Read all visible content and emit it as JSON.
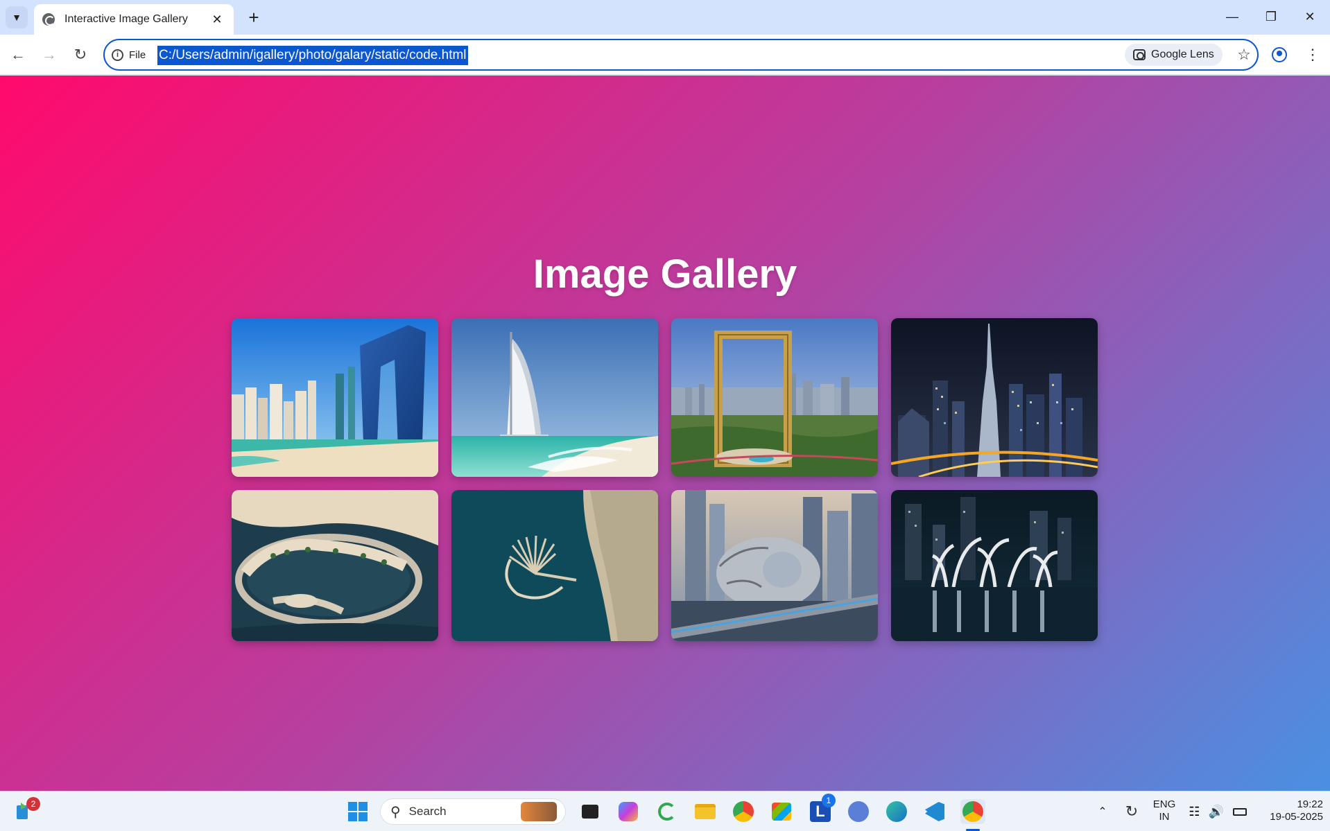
{
  "browser": {
    "tab_title": "Interactive Image Gallery",
    "site_info_label": "File",
    "url": "C:/Users/admin/igallery/photo/galary/static/code.html",
    "lens_label": "Google Lens"
  },
  "page": {
    "title": "Image Gallery",
    "gallery": [
      {
        "subject": "Dubai Marina beach and skyscrapers"
      },
      {
        "subject": "Burj Al Arab hotel on the beach"
      },
      {
        "subject": "Dubai Frame"
      },
      {
        "subject": "Burj Khalifa skyline at night"
      },
      {
        "subject": "Aerial view of island resort"
      },
      {
        "subject": "Palm Jumeirah aerial view"
      },
      {
        "subject": "Museum of the Future"
      },
      {
        "subject": "Dubai Fountain at night"
      }
    ]
  },
  "taskbar": {
    "search_placeholder": "Search",
    "widget_badge": "2",
    "language_line1": "ENG",
    "language_line2": "IN",
    "time": "19:22",
    "date": "19-05-2025",
    "l_badge": "1"
  },
  "colors": {
    "gradient_start": "#ff0a6c",
    "gradient_mid": "#b640a0",
    "gradient_end": "#4a90e2",
    "accent": "#0b57d0"
  }
}
